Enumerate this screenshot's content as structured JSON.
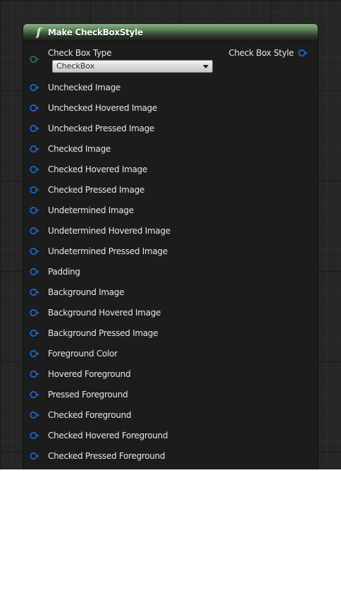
{
  "node": {
    "title": "Make CheckBoxStyle",
    "icon": "function-icon",
    "icon_glyph": "f",
    "header_color": "#6b8f66"
  },
  "type_pin": {
    "label": "Check Box Type",
    "color": "#1f7f6a",
    "dropdown_value": "CheckBox"
  },
  "output_pin": {
    "label": "Check Box Style",
    "color": "#1d6fe0"
  },
  "input_pins": [
    {
      "label": "Unchecked Image"
    },
    {
      "label": "Unchecked Hovered Image"
    },
    {
      "label": "Unchecked Pressed Image"
    },
    {
      "label": "Checked Image"
    },
    {
      "label": "Checked Hovered Image"
    },
    {
      "label": "Checked Pressed Image"
    },
    {
      "label": "Undetermined Image"
    },
    {
      "label": "Undetermined Hovered Image"
    },
    {
      "label": "Undetermined Pressed Image"
    },
    {
      "label": "Padding"
    },
    {
      "label": "Background Image"
    },
    {
      "label": "Background Hovered Image"
    },
    {
      "label": "Background Pressed Image"
    },
    {
      "label": "Foreground Color"
    },
    {
      "label": "Hovered Foreground"
    },
    {
      "label": "Pressed Foreground"
    },
    {
      "label": "Checked Foreground"
    },
    {
      "label": "Checked Hovered Foreground"
    },
    {
      "label": "Checked Pressed Foreground"
    }
  ],
  "colors": {
    "struct_pin": "#1d6fe0",
    "enum_pin": "#1f7f6a",
    "graph_background": "#262626",
    "node_body": "#1c1c1c"
  }
}
